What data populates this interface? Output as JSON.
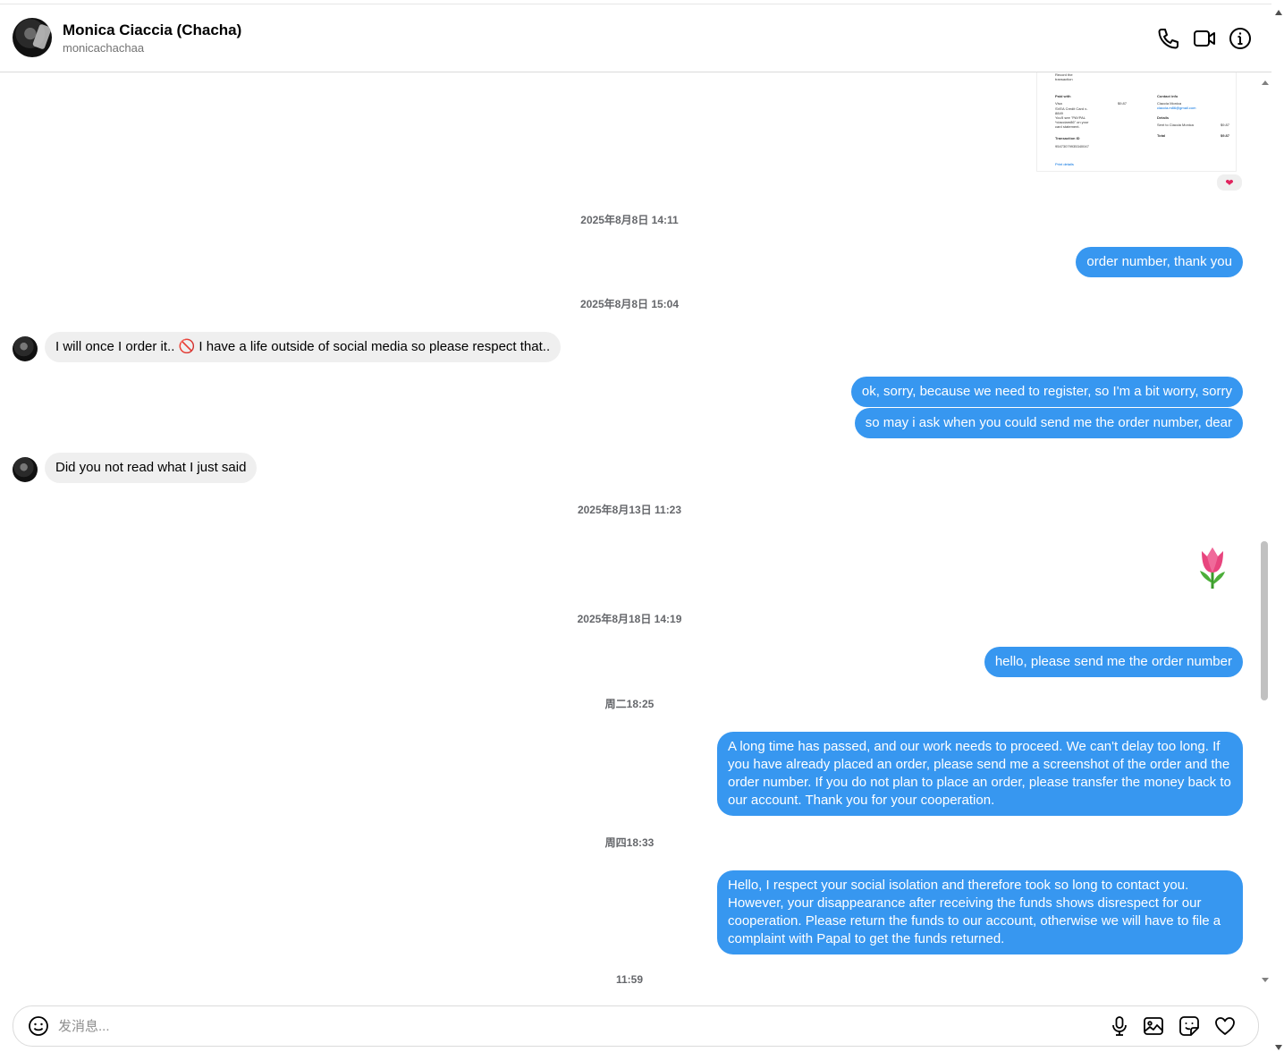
{
  "header": {
    "name": "Monica Ciaccia (Chacha)",
    "handle": "monicachachaa",
    "icons": [
      "phone-icon",
      "video-icon",
      "info-icon"
    ]
  },
  "receipt": {
    "lines": [
      "Record the",
      "transaction",
      "Paid with",
      "Visa",
      "SVEA Credit Card x-",
      "8849",
      "You'll see \"PAYPAL",
      "*ciacciam86\" on your",
      "card statement.",
      "Transaction ID",
      "95473079935340047",
      "Print details",
      "Contact info",
      "Ciaccia Monica",
      "ciaccia.m86@gmail.com",
      "Details",
      "Sent to Ciaccia Monica",
      "Total",
      "$9.87",
      "$9.87",
      "$9.87"
    ],
    "reaction": "❤"
  },
  "messages": [
    {
      "type": "timestamp",
      "text": "2025年8月8日 14:11"
    },
    {
      "type": "out",
      "text": "order number, thank you"
    },
    {
      "type": "timestamp",
      "text": "2025年8月8日 15:04"
    },
    {
      "type": "in",
      "text": "I will once I order it.. 🚫 I have a life outside of social media so please respect that.."
    },
    {
      "type": "out",
      "text": "ok, sorry, because we need to register, so I'm a bit worry, sorry"
    },
    {
      "type": "out",
      "text": "so may i ask when you could send me the order number, dear"
    },
    {
      "type": "in",
      "text": "Did you not read what I just said"
    },
    {
      "type": "timestamp",
      "text": "2025年8月13日 11:23"
    },
    {
      "type": "out-emoji",
      "emoji": "tulip"
    },
    {
      "type": "timestamp",
      "text": "2025年8月18日 14:19"
    },
    {
      "type": "out",
      "text": "hello, please send me the order number"
    },
    {
      "type": "timestamp",
      "text": "周二18:25"
    },
    {
      "type": "out",
      "text": "A long time has passed, and our work needs to proceed. We can't delay too long. If you have already placed an order, please send me a screenshot of the order and the order number. If you do not plan to place an order, please transfer the money back to our account. Thank you for your cooperation."
    },
    {
      "type": "timestamp",
      "text": "周四18:33"
    },
    {
      "type": "out",
      "text": "Hello, I respect your social isolation and therefore took so long to contact you. However, your disappearance after receiving the funds shows disrespect for our cooperation. Please return the funds to our account, otherwise we will have to file a complaint with Papal to get the funds returned."
    },
    {
      "type": "timestamp",
      "text": "11:59"
    }
  ],
  "composer": {
    "placeholder": "发消息...",
    "value": "",
    "icons": [
      "emoji-icon",
      "microphone-icon",
      "image-icon",
      "sticker-icon",
      "heart-icon"
    ]
  },
  "colors": {
    "outgoing_bubble": "#3797f0",
    "incoming_bubble": "#efefef",
    "timestamp_text": "#65676b"
  }
}
